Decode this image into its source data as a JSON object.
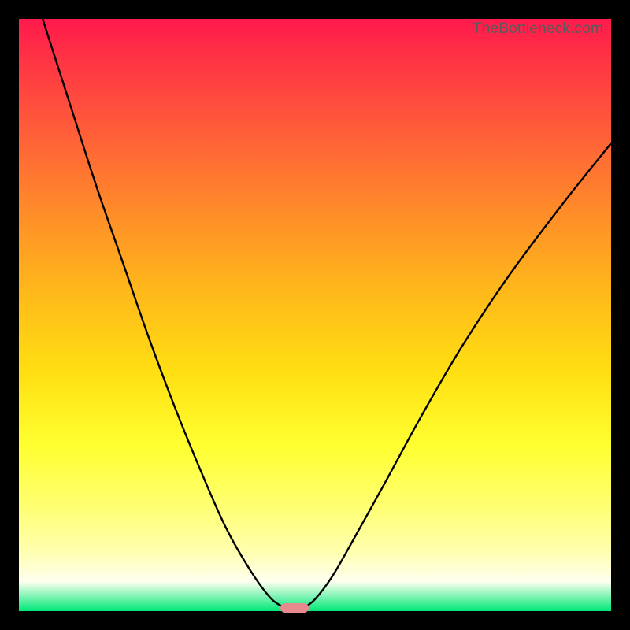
{
  "watermark": "TheBottleneck.com",
  "chart_data": {
    "type": "line",
    "title": "",
    "xlabel": "",
    "ylabel": "",
    "xlim": [
      0,
      100
    ],
    "ylim": [
      0,
      100
    ],
    "series": [
      {
        "name": "left-branch",
        "x": [
          4,
          8.5,
          13,
          17.5,
          22,
          26.5,
          31,
          35,
          39,
          42.5,
          45
        ],
        "values": [
          100,
          86,
          72,
          59,
          46,
          34,
          23,
          14,
          7,
          2.2,
          0.5
        ]
      },
      {
        "name": "right-branch",
        "x": [
          48,
          50,
          53,
          57,
          62,
          68,
          75,
          83,
          92,
          100
        ],
        "values": [
          0.5,
          2,
          6,
          13,
          22,
          33,
          45,
          57,
          69,
          79
        ]
      }
    ],
    "background_gradient": {
      "top": "#ff1a4d",
      "mid": "#ffe012",
      "bottom": "#00e878"
    },
    "marker": {
      "x": 46.5,
      "y": 0.5,
      "color": "#e68a8f"
    }
  }
}
